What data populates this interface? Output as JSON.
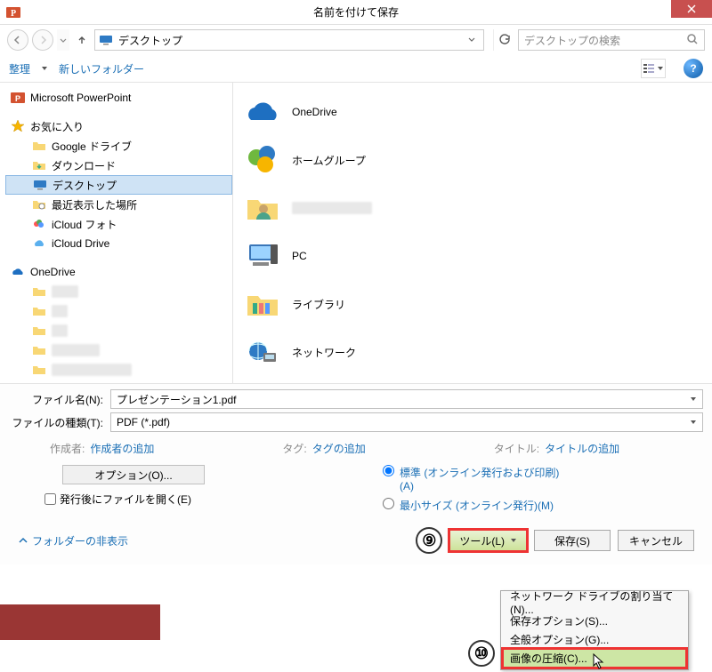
{
  "window": {
    "title": "名前を付けて保存"
  },
  "address": {
    "location": "デスクトップ"
  },
  "search": {
    "placeholder": "デスクトップの検索"
  },
  "toolbar": {
    "organize": "整理",
    "newfolder": "新しいフォルダー"
  },
  "tree": {
    "powerpoint": "Microsoft PowerPoint",
    "favorites": "お気に入り",
    "fav_items": [
      "Google ドライブ",
      "ダウンロード",
      "デスクトップ",
      "最近表示した場所",
      "iCloud フォト",
      "iCloud Drive"
    ],
    "onedrive": "OneDrive",
    "od_items": [
      "xxxxx",
      "xxx",
      "xxx",
      "xxxxxxxxx",
      "xxxxxxxxxxxxxxx"
    ]
  },
  "content": {
    "items": [
      "OneDrive",
      "ホームグループ",
      "xxxxxxxx",
      "PC",
      "ライブラリ",
      "ネットワーク"
    ]
  },
  "form": {
    "filename_label": "ファイル名(N):",
    "filename_value": "プレゼンテーション1.pdf",
    "filetype_label": "ファイルの種類(T):",
    "filetype_value": "PDF (*.pdf)"
  },
  "meta": {
    "author_k": "作成者:",
    "author_v": "作成者の追加",
    "tag_k": "タグ:",
    "tag_v": "タグの追加",
    "title_k": "タイトル:",
    "title_v": "タイトルの追加"
  },
  "options": {
    "button": "オプション(O)...",
    "open_after": "発行後にファイルを開く(E)",
    "radio_std": "標準 (オンライン発行および印刷)(A)",
    "radio_min": "最小サイズ (オンライン発行)(M)"
  },
  "bottom": {
    "hide_folders": "フォルダーの非表示",
    "tools": "ツール(L)",
    "save": "保存(S)",
    "cancel": "キャンセル"
  },
  "menu": {
    "map_drive": "ネットワーク ドライブの割り当て(N)...",
    "save_options": "保存オプション(S)...",
    "general_options": "全般オプション(G)...",
    "compress_pictures": "画像の圧縮(C)..."
  },
  "callouts": {
    "nine": "⑨",
    "ten": "⑩"
  }
}
